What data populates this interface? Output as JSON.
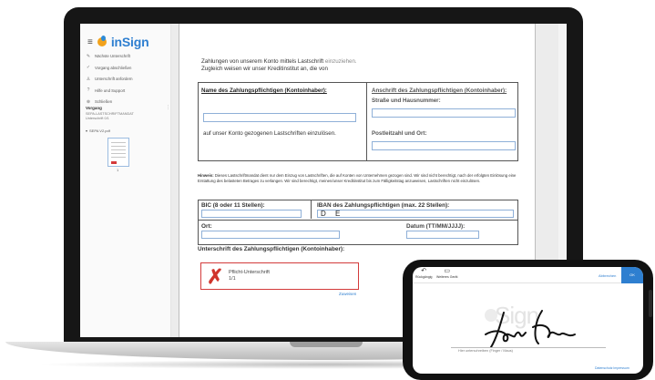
{
  "brand": {
    "name": "inSign",
    "accent": "#2e7fd0",
    "logo_orange": "#f2a21b"
  },
  "sidebar": {
    "menu_icon": "hamburger-icon",
    "items": [
      {
        "icon": "pen-icon",
        "label": "Nächste Unterschrift"
      },
      {
        "icon": "check-circle-icon",
        "label": "Vorgang abschließen"
      },
      {
        "icon": "add-person-icon",
        "label": "Unterschrift anfordern"
      },
      {
        "icon": "help-icon",
        "label": "Hilfe und Support"
      },
      {
        "icon": "close-circle-icon",
        "label": "Schließen"
      }
    ],
    "process": {
      "title": "Vorgang",
      "name": "SEPA-LASTSCHRIFTMANDAT",
      "progress": "Unterschrift 0/1",
      "file": "SEPA V2.pdf",
      "page_number": "1"
    }
  },
  "document": {
    "intro_line1": "Zahlungen von unserem Konto mittels Lastschrift",
    "intro_line1_muted": "einzuziehen.",
    "intro_line2": "Zugleich weisen wir unser Kreditinstitut an, die von",
    "payer_name_heading": "Name des Zahlungspflichtigen (Kontoinhaber):",
    "payer_address_heading": "Anschrift des Zahlungspflichtigen (Kontoinhaber):",
    "street_label": "Straße und Hausnummer:",
    "account_text": "auf unser Konto gezogenen Lastschriften einzulösen.",
    "postal_label": "Postleitzahl und Ort:",
    "hint_bold": "Hinweis:",
    "hint_text": "Dieses Lastschriftmandat dient nur dem Einzug von Lastschriften, die auf Konten von Unternehmen gezogen sind. Wir sind nicht berechtigt, nach der erfolgten Einlösung eine Erstattung des belasteten Betrages zu verlangen. Wir sind berechtigt, meinen/unser Kreditinstitut bis zum Fälligkeitstag anzuweisen, Lastschriften nicht einzulösen.",
    "bic_label": "BIC (8 oder 11 Stellen):",
    "iban_label": "IBAN des Zahlungspflichtigen (max. 22 Stellen):",
    "iban_value": "D E",
    "place_label": "Ort:",
    "date_label": "Datum (TT/MM/JJJJ):",
    "signature_heading": "Unterschrift des Zahlungspflichtigen (Kontoinhaber):",
    "signature_field_label": "Pflicht-Unterschrift",
    "signature_field_count": "1/1",
    "assign_link": "Zuweisen"
  },
  "phone": {
    "undo_label": "Rückgängig",
    "forward_label": "Weiteres Gerät",
    "cancel_label": "Abbrechen",
    "ok_label": "OK",
    "watermark": "Sign",
    "caption": "Hier unterschreiben (Finger / Maus)",
    "footer": "Datenschutz  Impressum"
  }
}
